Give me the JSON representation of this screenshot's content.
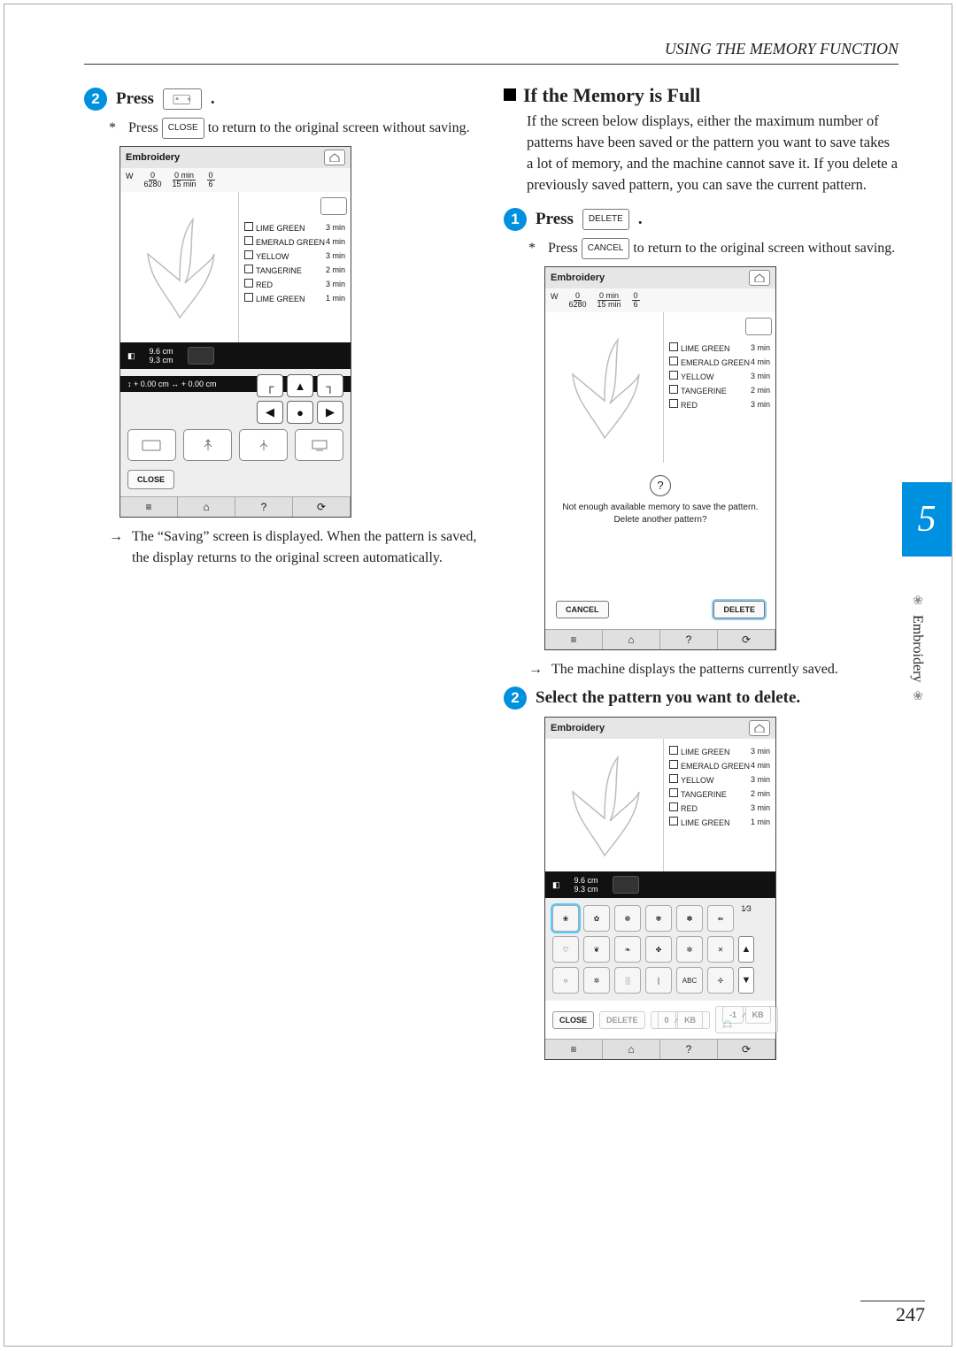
{
  "header": "USING THE MEMORY FUNCTION",
  "page_number": "247",
  "side_tab": {
    "number": "5",
    "label": "Embroidery"
  },
  "left": {
    "step2": {
      "label": "Press",
      "period": "."
    },
    "note1": {
      "pre": "Press",
      "button": "CLOSE",
      "post": "to return to the original screen without saving."
    },
    "arrow_note": "The “Saving” screen is displayed. When the pattern is saved, the display returns to the original screen automatically.",
    "screen1": {
      "title": "Embroidery",
      "stats": {
        "stitches": {
          "top": "0",
          "bot": "6280"
        },
        "time": {
          "top": "0 min",
          "bot": "15 min"
        },
        "colors": {
          "top": "0",
          "bot": "6"
        }
      },
      "size": {
        "h": "9.6 cm",
        "w": "9.3 cm"
      },
      "pos": "↕  +  0.00 cm   ↔   +  0.00 cm",
      "close": "CLOSE"
    }
  },
  "right": {
    "heading": "If the Memory is Full",
    "intro": "If the screen below displays, either the maximum number of patterns have been saved or the pattern you want to save takes a lot of memory, and the machine cannot save it. If you delete a previously saved pattern, you can save the current pattern.",
    "step1": {
      "label": "Press",
      "button": "DELETE",
      "period": "."
    },
    "note1": {
      "pre": "Press",
      "button": "CANCEL",
      "post": "to return to the original screen without saving."
    },
    "dialog": {
      "title": "Embroidery",
      "msg": "Not enough available memory to save the pattern. Delete another pattern?",
      "cancel": "CANCEL",
      "delete": "DELETE"
    },
    "arrow_note": "The machine displays the patterns currently saved.",
    "step2": "Select the pattern you want to delete.",
    "screen3": {
      "title": "Embroidery",
      "size": {
        "h": "9.6 cm",
        "w": "9.3 cm"
      },
      "page": {
        "cur": "1",
        "tot": "3"
      },
      "close": "CLOSE",
      "delete": "DELETE",
      "kb0": "0",
      "kbn1": "-1",
      "kb": "KB"
    }
  },
  "colors_list": [
    {
      "name": "LIME GREEN",
      "time": "3 min"
    },
    {
      "name": "EMERALD GREEN",
      "time": "4 min"
    },
    {
      "name": "YELLOW",
      "time": "3 min"
    },
    {
      "name": "TANGERINE",
      "time": "2 min"
    },
    {
      "name": "RED",
      "time": "3 min"
    },
    {
      "name": "LIME GREEN",
      "time": "1 min"
    }
  ],
  "colors_list_short": [
    {
      "name": "LIME GREEN",
      "time": "3 min"
    },
    {
      "name": "EMERALD GREEN",
      "time": "4 min"
    },
    {
      "name": "YELLOW",
      "time": "3 min"
    },
    {
      "name": "TANGERINE",
      "time": "2 min"
    },
    {
      "name": "RED",
      "time": "3 min"
    }
  ]
}
